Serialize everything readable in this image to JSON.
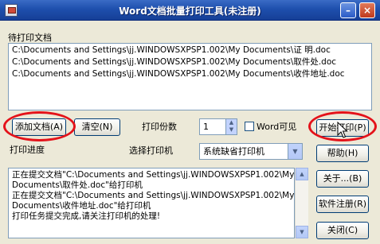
{
  "window": {
    "title": "Word文档批量打印工具(未注册)",
    "minimize_glyph": "–",
    "close_glyph": "×"
  },
  "files": {
    "label": "待打印文档",
    "items": [
      "C:\\Documents and Settings\\jj.WINDOWSXPSP1.002\\My Documents\\证  明.doc",
      "C:\\Documents and Settings\\jj.WINDOWSXPSP1.002\\My Documents\\取件处.doc",
      "C:\\Documents and Settings\\jj.WINDOWSXPSP1.002\\My Documents\\收件地址.doc"
    ]
  },
  "controls": {
    "add_button": "添加文档(A)",
    "clear_button": "清空(N)",
    "copies_label": "打印份数",
    "copies_value": "1",
    "word_visible_label": "Word可见",
    "word_visible_checked": false,
    "start_button": "开始打印(P)",
    "progress_label": "打印进度",
    "printer_label": "选择打印机",
    "printer_value": "系统缺省打印机",
    "help_button": "帮助(H)",
    "about_button": "关于...(B)",
    "register_button": "软件注册(R)",
    "close_button": "关闭(C)"
  },
  "log": {
    "lines": [
      "正在提交文档\"C:\\Documents and Settings\\jj.WINDOWSXPSP1.002\\My",
      "Documents\\取件处.doc\"给打印机",
      "正在提交文档\"C:\\Documents and Settings\\jj.WINDOWSXPSP1.002\\My",
      "Documents\\收件地址.doc\"给打印机",
      "打印任务提交完成,请关注打印机的处理!"
    ]
  },
  "colors": {
    "titlebar": "#1E4FAD",
    "highlight_oval": "#E4121A",
    "window_bg": "#ECE9D8"
  }
}
